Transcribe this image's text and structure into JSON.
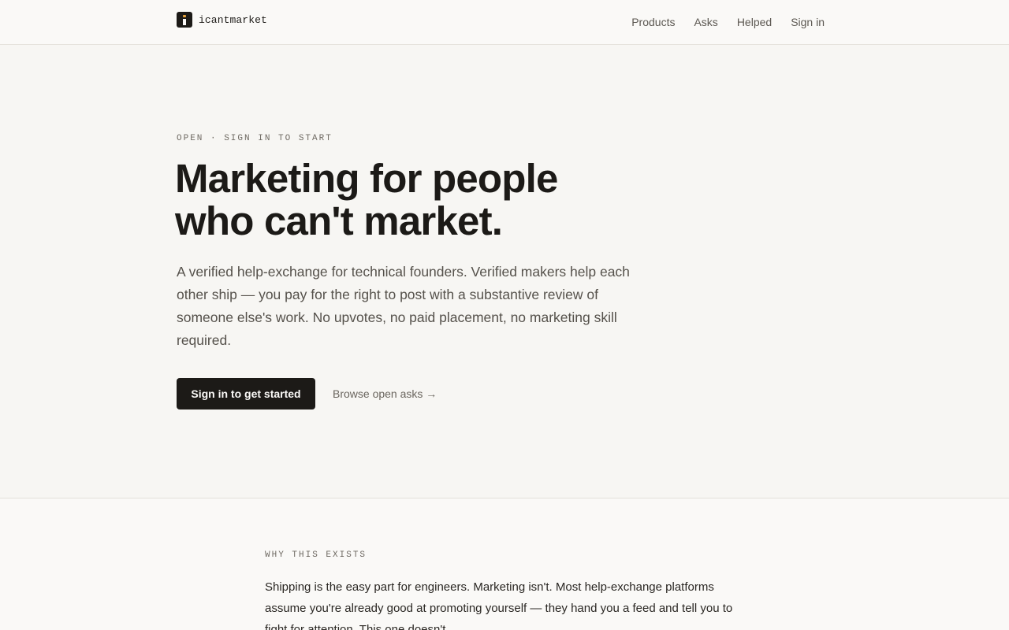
{
  "header": {
    "brand_name": "icantmarket",
    "brand_icon": "i-logo-icon",
    "nav": [
      {
        "label": "Products"
      },
      {
        "label": "Asks"
      },
      {
        "label": "Helped"
      },
      {
        "label": "Sign in"
      }
    ]
  },
  "hero": {
    "eyebrow": "OPEN · SIGN IN TO START",
    "title_line1": "Marketing for people",
    "title_line2": "who can't market.",
    "lead": "A verified help-exchange for technical founders. Verified makers help each other ship — you pay for the right to post with a substantive review of someone else's work. No upvotes, no paid placement, no marketing skill required.",
    "primary_cta": "Sign in to get started",
    "secondary_cta": "Browse open asks →"
  },
  "why": {
    "label": "WHY THIS EXISTS",
    "body": "Shipping is the easy part for engineers. Marketing isn't. Most help-exchange platforms assume you're already good at promoting yourself — they hand you a feed and tell you to fight for attention. This one doesn't."
  },
  "colors": {
    "background": "#f7f6f3",
    "ink": "#1c1a17",
    "muted": "#5c5852",
    "accent": "#e8a33c"
  }
}
